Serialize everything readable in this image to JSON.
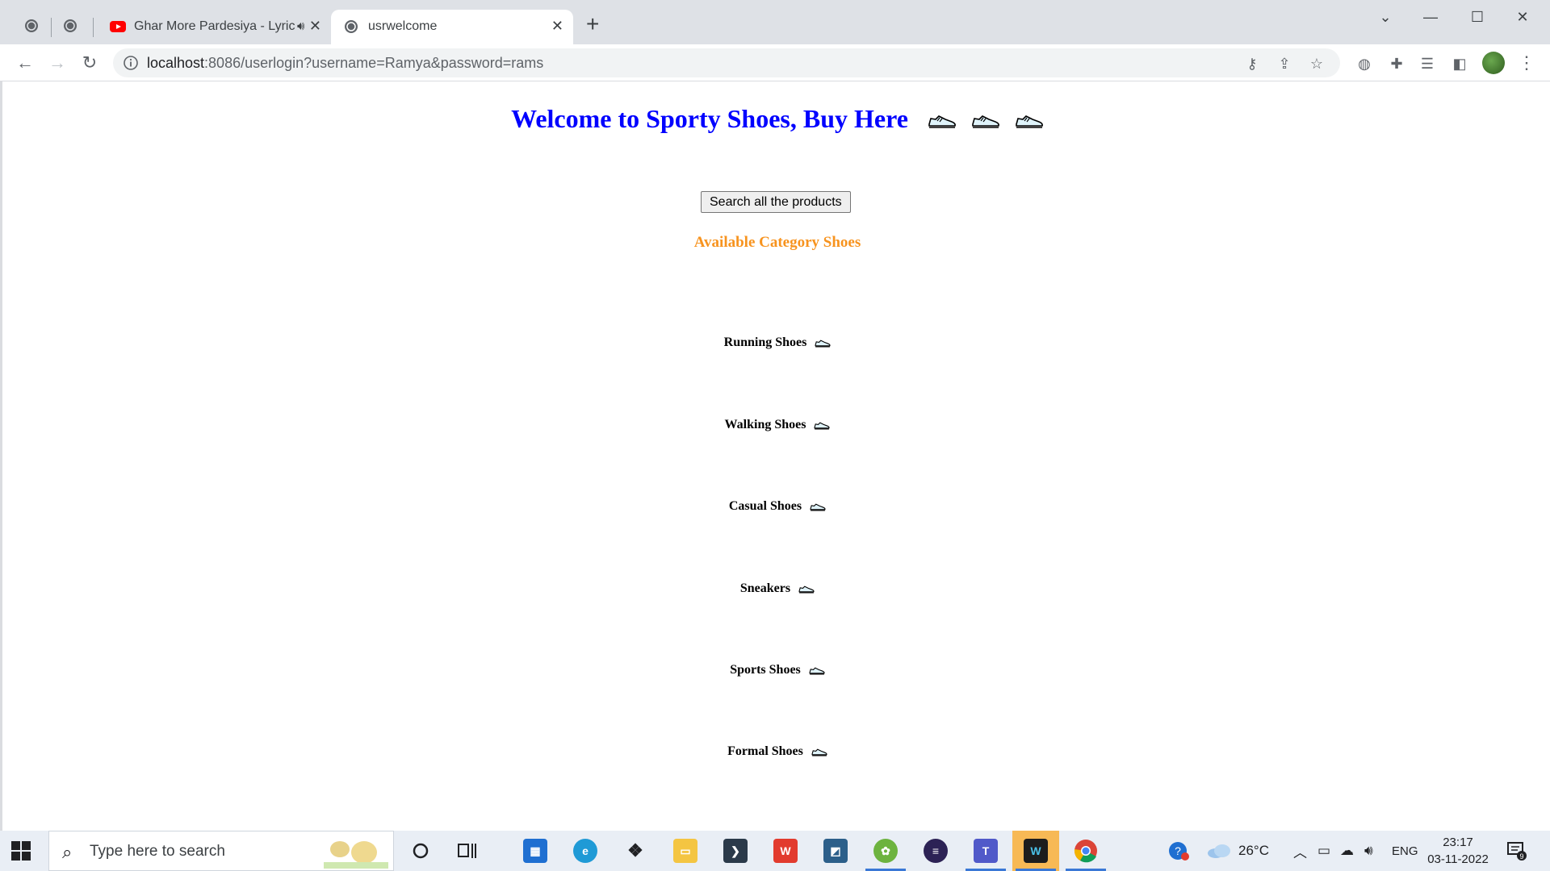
{
  "browser": {
    "tabs": [
      {
        "title": "Ghar More Pardesiya - Lyrical",
        "favicon": "youtube-icon",
        "muted_icon": "speaker-icon"
      },
      {
        "title": "usrwelcome",
        "favicon": "globe-icon",
        "active": true
      }
    ],
    "new_tab_label": "+",
    "url_host": "localhost",
    "url_rest": ":8086/userlogin?username=Ramya&password=rams"
  },
  "page": {
    "welcome": "Welcome to Sporty Shoes, Buy Here",
    "search_button": "Search all the products",
    "available_title": "Available Category Shoes",
    "categories": [
      {
        "label": "Running Shoes"
      },
      {
        "label": "Walking Shoes"
      },
      {
        "label": "Casual Shoes"
      },
      {
        "label": "Sneakers"
      },
      {
        "label": "Sports Shoes"
      },
      {
        "label": "Formal Shoes"
      }
    ]
  },
  "taskbar": {
    "search_placeholder": "Type here to search",
    "weather": "26°C",
    "language": "ENG",
    "time": "23:17",
    "date": "03-11-2022",
    "notification_count": "9"
  },
  "colors": {
    "welcome": "#0000ff",
    "available_title": "#f7931e",
    "tabstrip": "#dee1e6",
    "taskbar": "#e9eef5"
  }
}
